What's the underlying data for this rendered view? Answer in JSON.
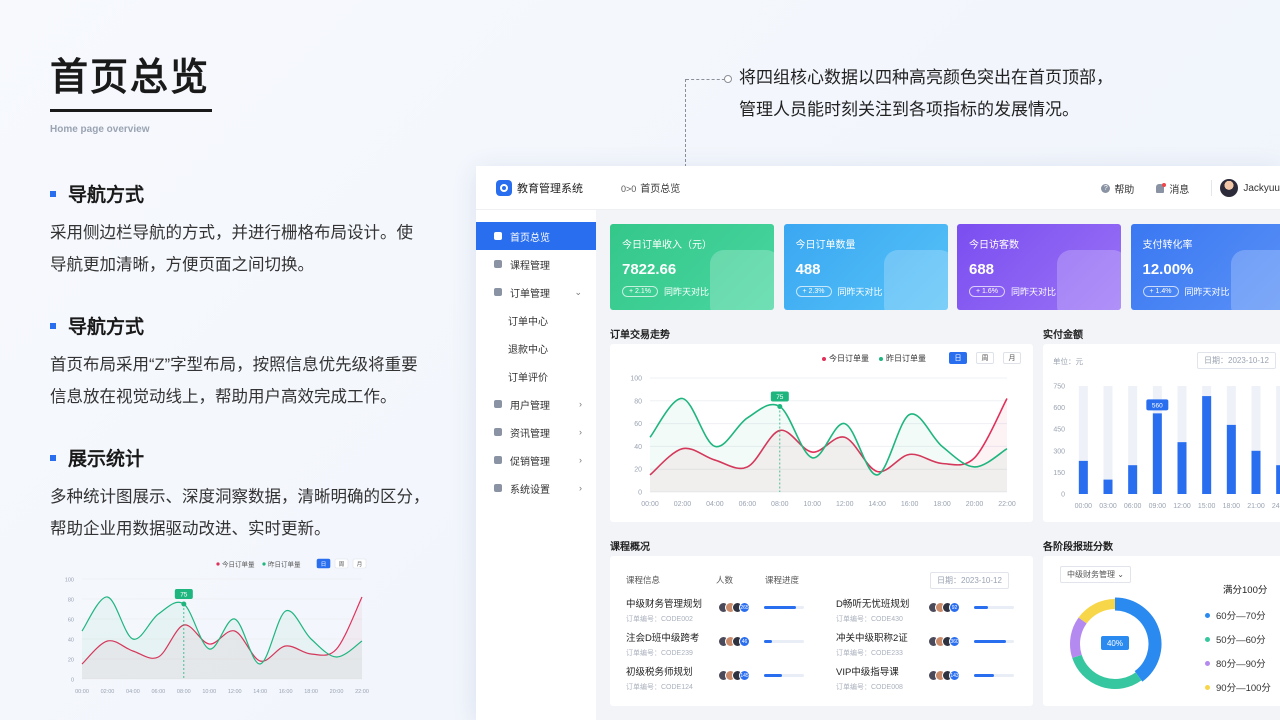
{
  "intro": {
    "title": "首页总览",
    "subtitle": "Home page overview"
  },
  "sections": [
    {
      "title": "导航方式",
      "body_line1": "采用侧边栏导航的方式，并进行栅格布局设计。使",
      "body_line2": "导航更加清晰，方便页面之间切换。"
    },
    {
      "title": "导航方式",
      "body_line1": "首页布局采用“Z”字型布局，按照信息优先级将重要",
      "body_line2": "信息放在视觉动线上，帮助用户高效完成工作。"
    },
    {
      "title": "展示统计",
      "body_line1": "多种统计图展示、深度洞察数据，清晰明确的区分，",
      "body_line2": "帮助企业用数据驱动改进、实时更新。"
    }
  ],
  "callout": {
    "line1": "将四组核心数据以四种高亮颜色突出在首页顶部，",
    "line2": "管理人员能时刻关注到各项指标的发展情况。"
  },
  "dashboard": {
    "app_title": "教育管理系统",
    "breadcrumb_icon": "0>0",
    "breadcrumb": "首页总览",
    "help": "帮助",
    "messages": "消息",
    "user": "Jackyuu",
    "nav": [
      {
        "label": "首页总览",
        "icon": "home-icon"
      },
      {
        "label": "课程管理",
        "icon": "book-icon"
      },
      {
        "label": "订单管理",
        "icon": "order-icon",
        "chevron": "⌄"
      },
      {
        "label": "订单中心",
        "sub": true
      },
      {
        "label": "退款中心",
        "sub": true
      },
      {
        "label": "订单评价",
        "sub": true
      },
      {
        "label": "用户管理",
        "icon": "user-icon",
        "chevron": "›"
      },
      {
        "label": "资讯管理",
        "icon": "news-icon",
        "chevron": "›"
      },
      {
        "label": "促销管理",
        "icon": "promo-icon",
        "chevron": "›"
      },
      {
        "label": "系统设置",
        "icon": "gear-icon",
        "chevron": "›"
      }
    ],
    "cards": [
      {
        "label": "今日订单收入（元）",
        "value": "7822.66",
        "change": "+ 2.1%",
        "compare": "同昨天对比",
        "color1": "#34c78a",
        "color2": "#48d6a0"
      },
      {
        "label": "今日订单数量",
        "value": "488",
        "change": "+ 2.3%",
        "compare": "同昨天对比",
        "color1": "#3aa7f2",
        "color2": "#56c2f7"
      },
      {
        "label": "今日访客数",
        "value": "688",
        "change": "+ 1.6%",
        "compare": "同昨天对比",
        "color1": "#7a4ef0",
        "color2": "#9a72f6"
      },
      {
        "label": "支付转化率",
        "value": "12.00%",
        "change": "+ 1.4%",
        "compare": "同昨天对比",
        "color1": "#3a78f2",
        "color2": "#5b92f7"
      }
    ],
    "trend": {
      "title": "订单交易走势",
      "legend_today": "今日订单量",
      "legend_yesterday": "昨日订单量",
      "tabs": [
        "日",
        "周",
        "月"
      ],
      "marker_label": "75"
    },
    "paid": {
      "title": "实付金额",
      "unit": "单位：元",
      "date": "日期：2023-10-12",
      "marker_label": "560"
    },
    "courses": {
      "title": "课程概况",
      "col_info": "课程信息",
      "col_people": "人数",
      "col_progress": "课程进度",
      "date": "日期：2023-10-12",
      "items": [
        {
          "name": "中级财务管理规划",
          "code": "订单编号：CODE002",
          "count": "265",
          "progress": 0.8
        },
        {
          "name": "D畅听无忧班规划",
          "code": "订单编号：CODE430",
          "count": "92",
          "progress": 0.35
        },
        {
          "name": "注会D班中级跨考",
          "code": "订单编号：CODE239",
          "count": "46",
          "progress": 0.2
        },
        {
          "name": "冲关中级职称2证",
          "code": "订单编号：CODE233",
          "count": "360",
          "progress": 0.8
        },
        {
          "name": "初级税务师规划",
          "code": "订单编号：CODE124",
          "count": "145",
          "progress": 0.45
        },
        {
          "name": "VIP中级指导课",
          "code": "订单编号：CODE008",
          "count": "143",
          "progress": 0.5
        }
      ]
    },
    "scores": {
      "title": "各阶段报班分数",
      "select": "中级财务管理",
      "center": "40%",
      "total": "满分100分",
      "legend": [
        {
          "label": "60分—70分",
          "color": "#2a8af0"
        },
        {
          "label": "50分—60分",
          "color": "#36c7a0"
        },
        {
          "label": "80分—90分",
          "color": "#b58af0"
        },
        {
          "label": "90分—100分",
          "color": "#f7d64a"
        }
      ]
    }
  },
  "chart_data": [
    {
      "type": "line",
      "x": [
        "00:00",
        "02:00",
        "04:00",
        "06:00",
        "08:00",
        "10:00",
        "12:00",
        "14:00",
        "16:00",
        "18:00",
        "20:00",
        "22:00"
      ],
      "ylim": [
        0,
        100
      ],
      "yticks": [
        0,
        20,
        40,
        60,
        80,
        100
      ],
      "series": [
        {
          "name": "今日订单量",
          "color": "#e0305a",
          "values": [
            15,
            38,
            28,
            22,
            54,
            35,
            48,
            18,
            33,
            25,
            30,
            82
          ]
        },
        {
          "name": "昨日订单量",
          "color": "#1fb57f",
          "values": [
            48,
            82,
            40,
            65,
            75,
            30,
            60,
            15,
            68,
            40,
            22,
            38
          ]
        }
      ]
    },
    {
      "type": "bar",
      "categories": [
        "00:00",
        "03:00",
        "06:00",
        "09:00",
        "12:00",
        "15:00",
        "18:00",
        "21:00",
        "24:00"
      ],
      "yticks": [
        0,
        150,
        300,
        450,
        600,
        750
      ],
      "ylim": [
        0,
        750
      ],
      "values": [
        230,
        100,
        200,
        560,
        360,
        680,
        480,
        300,
        200
      ],
      "color": "#2a6ef0"
    },
    {
      "type": "pie",
      "values": [
        40,
        30,
        15,
        15
      ],
      "colors": [
        "#2a8af0",
        "#36c7a0",
        "#b58af0",
        "#f7d64a"
      ]
    }
  ]
}
